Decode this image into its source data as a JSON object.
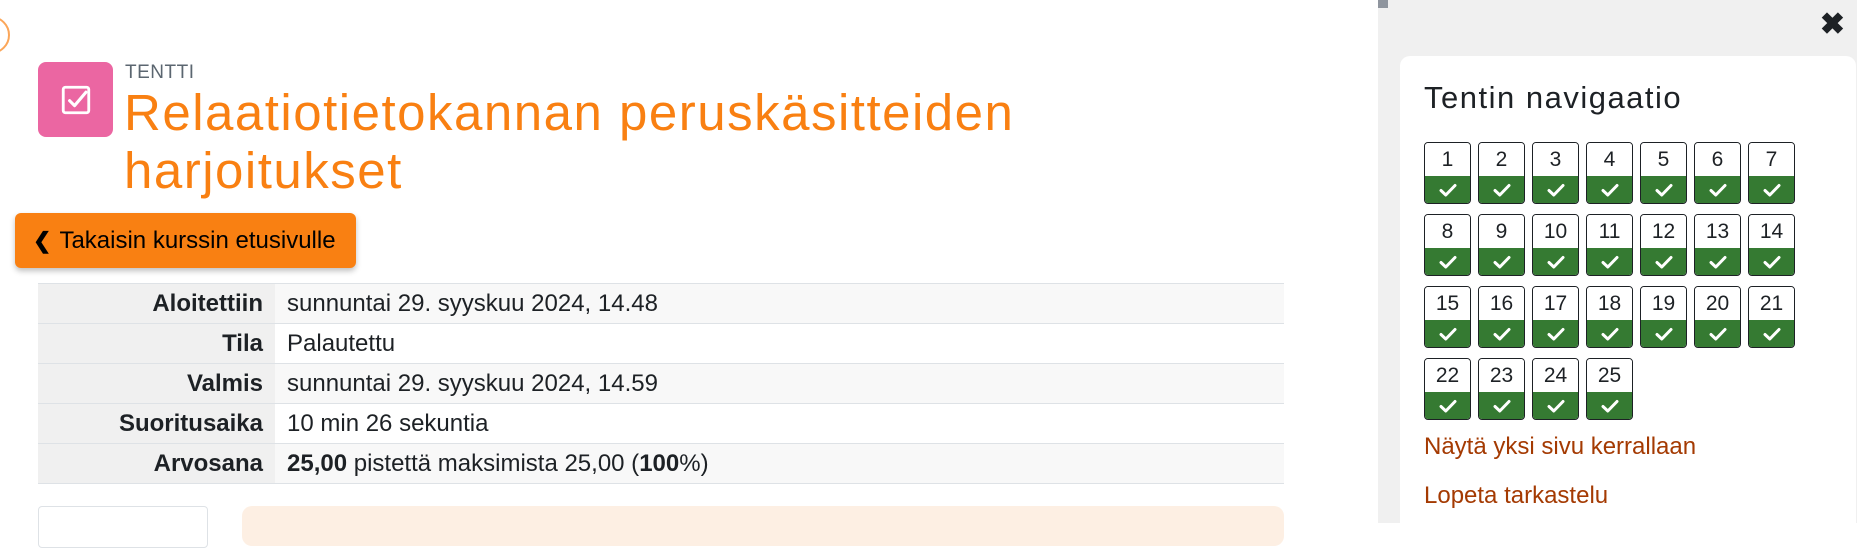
{
  "activity": {
    "type_label": "TENTTI",
    "title": "Relaatiotietokannan peruskäsitteiden harjoitukset",
    "icon": "checkbox-icon",
    "icon_color": "#eb66a2"
  },
  "back_button": {
    "label": "Takaisin kurssin etusivulle",
    "icon": "chevron-left-icon"
  },
  "summary": {
    "rows": [
      {
        "label": "Aloitettiin",
        "value": "sunnuntai 29. syyskuu 2024, 14.48"
      },
      {
        "label": "Tila",
        "value": "Palautettu"
      },
      {
        "label": "Valmis",
        "value": "sunnuntai 29. syyskuu 2024, 14.59"
      },
      {
        "label": "Suoritusaika",
        "value": "10 min 26 sekuntia"
      }
    ],
    "grade": {
      "label": "Arvosana",
      "points": "25,00",
      "text_mid": " pistettä maksimista 25,00 (",
      "percent": "100",
      "text_end": "%)"
    }
  },
  "drawer": {
    "close_icon": "close-icon",
    "title": "Tentin navigaatio",
    "questions": [
      "1",
      "2",
      "3",
      "4",
      "5",
      "6",
      "7",
      "8",
      "9",
      "10",
      "11",
      "12",
      "13",
      "14",
      "15",
      "16",
      "17",
      "18",
      "19",
      "20",
      "21",
      "22",
      "23",
      "24",
      "25"
    ],
    "question_state": "correct",
    "state_icon": "check-icon",
    "state_color": "#357a32",
    "links": {
      "show_one_page": "Näytä yksi sivu kerrallaan",
      "finish_review": "Lopeta tarkastelu"
    }
  },
  "colors": {
    "accent": "#f98012",
    "link": "#a43a02"
  }
}
